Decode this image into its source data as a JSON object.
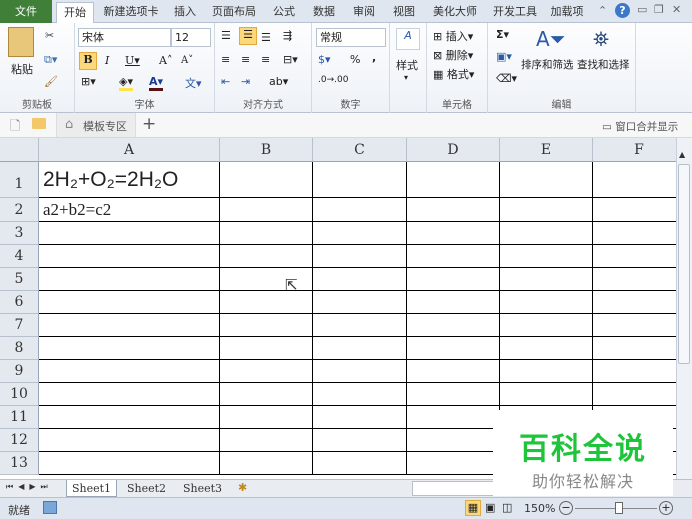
{
  "tabs": [
    "文件",
    "开始",
    "新建选项卡",
    "插入",
    "页面布局",
    "公式",
    "数据",
    "审阅",
    "视图",
    "美化大师",
    "开发工具",
    "加载项"
  ],
  "ribbon": {
    "clipboard": {
      "paste": "粘贴",
      "label": "剪贴板"
    },
    "font": {
      "name": "宋体",
      "size": "12",
      "label": "字体"
    },
    "alignment": {
      "label": "对齐方式"
    },
    "number": {
      "format": "常规",
      "percent": "%",
      "comma": ",",
      "label": "数字"
    },
    "styles": {
      "button": "样式"
    },
    "cells": {
      "insert": "插入",
      "delete": "删除",
      "format": "格式",
      "label": "单元格"
    },
    "editing": {
      "sum": "Σ",
      "sort": "排序和筛选",
      "find": "查找和选择",
      "label": "编辑"
    }
  },
  "docbar": {
    "template_tab": "模板专区",
    "add": "+",
    "merge_window": "窗口合并显示"
  },
  "sheet": {
    "columns": [
      "A",
      "B",
      "C",
      "D",
      "E",
      "F"
    ],
    "rows": [
      "1",
      "2",
      "3",
      "4",
      "5",
      "6",
      "7",
      "8",
      "9",
      "10",
      "11",
      "12",
      "13"
    ],
    "cells": {
      "A1": "2H₂+O₂=2H₂O",
      "A2": "a2+b2=c2"
    }
  },
  "sheet_tabs": [
    "Sheet1",
    "Sheet2",
    "Sheet3"
  ],
  "status": {
    "ready": "就绪",
    "zoom": "150%",
    "zoom_out": "−",
    "zoom_in": "+"
  },
  "watermark": {
    "title": "百科全说",
    "subtitle": "助你轻松解决"
  }
}
